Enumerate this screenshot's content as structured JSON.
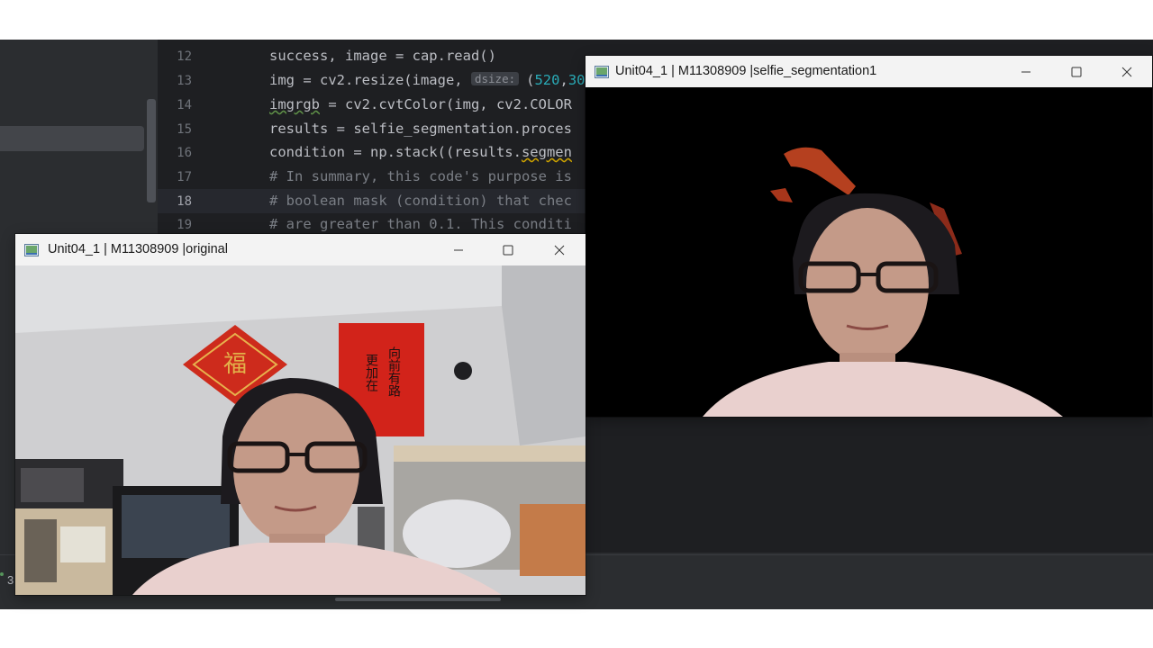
{
  "editor": {
    "lines": [
      {
        "num": "12",
        "before": "success, image = cap.read()"
      },
      {
        "num": "13",
        "before": "img = cv2.resize(image, ",
        "hint": "dsize:",
        "after_open": "(",
        "number_a": "520",
        "comma": ",",
        "number_b": "30"
      },
      {
        "num": "14",
        "warn": "imgrgb",
        "before": " = cv2.cvtColor(img, cv2.COLOR"
      },
      {
        "num": "15",
        "before": "results = selfie_segmentation.proces"
      },
      {
        "num": "16",
        "before": "condition = np.stack((results.",
        "warn": "segmen"
      },
      {
        "num": "17",
        "comment": "# In summary, this code's purpose is"
      },
      {
        "num": "18",
        "comment": "# boolean mask (condition) that chec"
      },
      {
        "num": "19",
        "comment": "# are greater than 0.1. This conditi"
      }
    ],
    "bottom_mark": "3"
  },
  "windows": {
    "segmentation": {
      "title": "Unit04_1 | M11308909 |selfie_segmentation1",
      "minimize_icon": "minimize-icon",
      "maximize_icon": "maximize-icon",
      "close_icon": "close-icon"
    },
    "original": {
      "title": "Unit04_1 | M11308909 |original",
      "minimize_icon": "minimize-icon",
      "maximize_icon": "maximize-icon",
      "close_icon": "close-icon"
    }
  },
  "poster": {
    "diamond_char": "福",
    "scroll_lines": [
      "向前有路",
      "更加在"
    ]
  },
  "colors": {
    "editor_bg": "#1e1f22",
    "ide_bg": "#2b2d30",
    "code_text": "#bcbec4",
    "number": "#2aacb8",
    "comment": "#7a7e85",
    "titlebar": "#f3f3f3",
    "poster_red": "#d2231a"
  }
}
